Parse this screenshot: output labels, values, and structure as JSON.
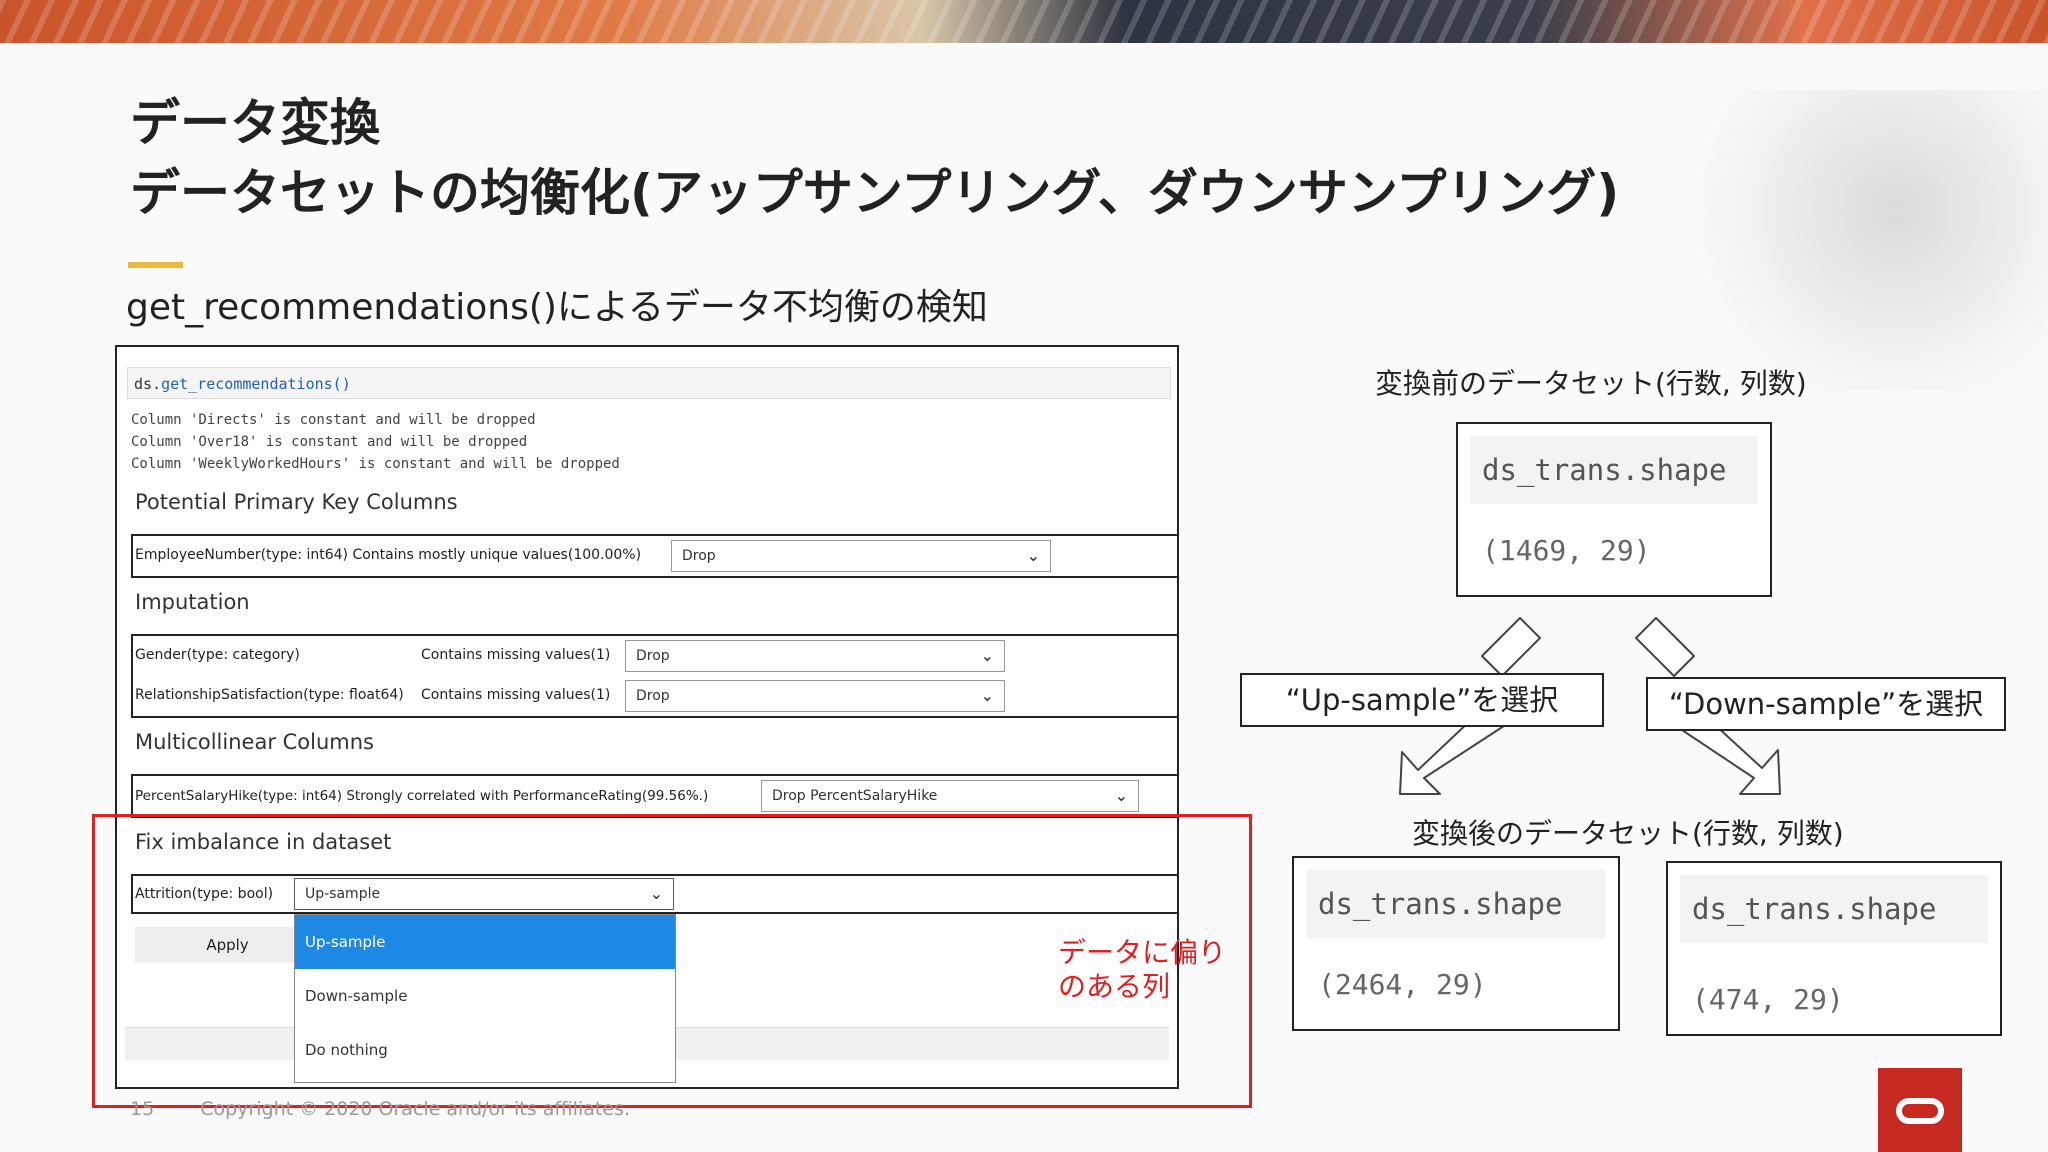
{
  "slide": {
    "title_line1": "データ変換",
    "title_line2": "データセットの均衡化(アップサンプリング、ダウンサンプリング)",
    "subtitle": "get_recommendations()によるデータ不均衡の検知",
    "footer_page": "15",
    "footer_copyright": "Copyright © 2020 Oracle and/or its affiliates."
  },
  "notebook": {
    "cell_object": "ds.",
    "cell_function": "get_recommendations()",
    "output_lines": [
      "Column 'Directs' is constant and will be dropped",
      "Column 'Over18' is constant and will be dropped",
      "Column 'WeeklyWorkedHours' is constant and will be dropped"
    ],
    "sections": {
      "primary_key": {
        "heading": "Potential Primary Key Columns",
        "label": "EmployeeNumber(type: int64) Contains mostly unique values(100.00%)",
        "value": "Drop"
      },
      "imputation": {
        "heading": "Imputation",
        "rows": [
          {
            "label": "Gender(type: category)",
            "reason": "Contains missing values(1)",
            "value": "Drop"
          },
          {
            "label": "RelationshipSatisfaction(type: float64)",
            "reason": "Contains missing values(1)",
            "value": "Drop"
          }
        ]
      },
      "multicollinear": {
        "heading": "Multicollinear Columns",
        "label": "PercentSalaryHike(type: int64) Strongly correlated with PerformanceRating(99.56%.)",
        "value": "Drop PercentSalaryHike"
      },
      "imbalance": {
        "heading": "Fix imbalance in dataset",
        "label": "Attrition(type: bool)",
        "value": "Up-sample",
        "options": [
          "Up-sample",
          "Down-sample",
          "Do nothing"
        ]
      }
    },
    "apply_label": "Apply"
  },
  "annotation": {
    "line1": "データに偏り",
    "line2": "のある列"
  },
  "before": {
    "label": "変換前のデータセット(行数, 列数)",
    "code": "ds_trans.shape",
    "output": "(1469, 29)"
  },
  "choices": {
    "up": "“Up-sample”を選択",
    "down": "“Down-sample”を選択"
  },
  "after": {
    "label": "変換後のデータセット(行数, 列数)",
    "up_code": "ds_trans.shape",
    "up_output": "(2464, 29)",
    "down_code": "ds_trans.shape",
    "down_output": "(474, 29)"
  },
  "colors": {
    "accent_red": "#e02020",
    "dropdown_highlight": "#1e88e5",
    "oracle_red": "#c5291f",
    "title_underline": "#f0b63a"
  }
}
